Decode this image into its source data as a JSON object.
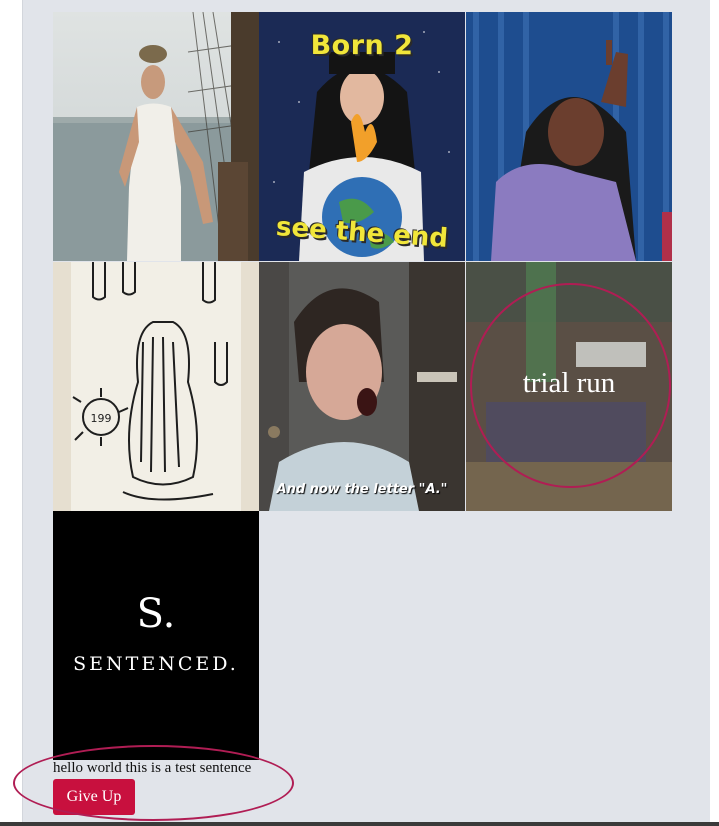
{
  "grid": {
    "tiles": [
      {
        "id": "tile-1",
        "image": "man-in-tank-top-on-boat"
      },
      {
        "id": "tile-2",
        "image": "woman-with-burning-globe",
        "caption_top": "Born 2",
        "caption_bottom": "see the end"
      },
      {
        "id": "tile-3",
        "image": "singer-pointing-up"
      },
      {
        "id": "tile-4",
        "image": "sketch-of-hairy-creature"
      },
      {
        "id": "tile-5",
        "image": "woman-shouting",
        "subtitle": "And now the letter \"A.\""
      },
      {
        "id": "tile-6",
        "image": "blurred-scene",
        "overlay_label": "trial run"
      },
      {
        "id": "tile-7",
        "image": "sentenced-title-card",
        "title_letter": "S.",
        "title_word": "SENTENCED."
      }
    ]
  },
  "footer": {
    "sentence": "hello world this is a test sentence",
    "give_up_label": "Give Up"
  },
  "colors": {
    "panel": "#e1e4ea",
    "button": "#c8103e",
    "annotation_ring": "#b01d54",
    "meme_text": "#f1e63a"
  }
}
